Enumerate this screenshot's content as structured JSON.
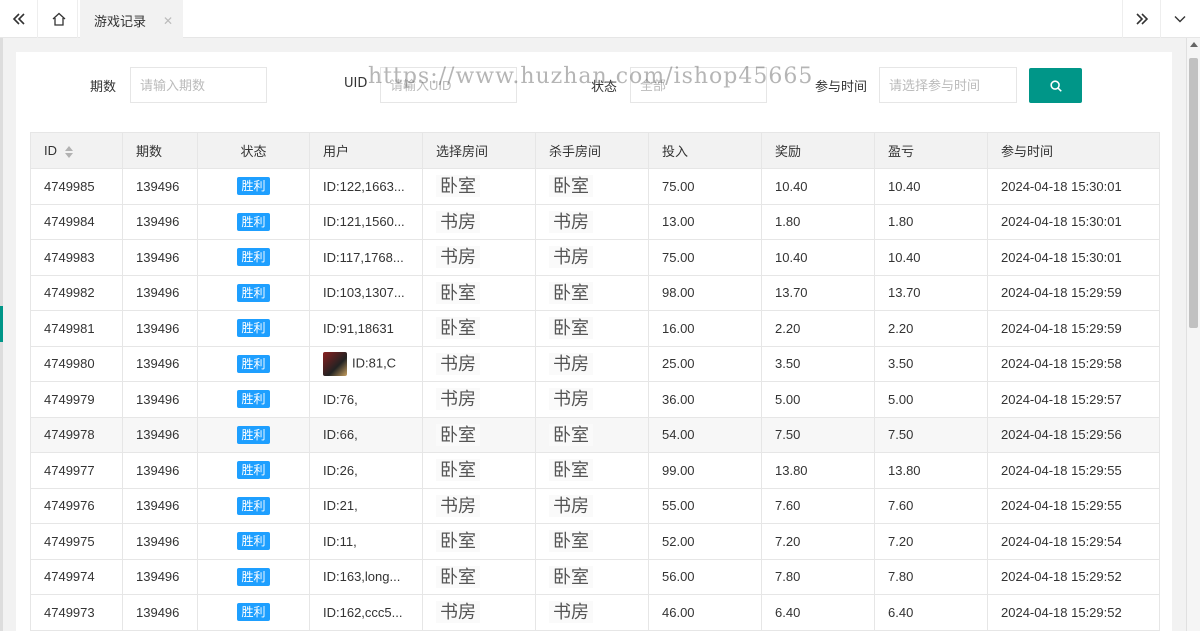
{
  "tabs": {
    "active_label": "游戏记录"
  },
  "search": {
    "period_label": "期数",
    "period_placeholder": "请输入期数",
    "uid_label": "UID",
    "uid_placeholder": "请输入UID",
    "status_label": "状态",
    "status_placeholder": "全部",
    "time_label": "参与时间",
    "time_placeholder": "请选择参与时间"
  },
  "watermark": "https://www.huzhan.com/ishop45665",
  "table": {
    "headers": [
      "ID",
      "期数",
      "状态",
      "用户",
      "选择房间",
      "杀手房间",
      "投入",
      "奖励",
      "盈亏",
      "参与时间"
    ],
    "rows": [
      {
        "id": "4749985",
        "period": "139496",
        "status": "胜利",
        "user": "ID:122,1663...",
        "choose": "卧室",
        "killer": "卧室",
        "bet": "75.00",
        "reward": "10.40",
        "profit": "10.40",
        "time": "2024-04-18 15:30:01"
      },
      {
        "id": "4749984",
        "period": "139496",
        "status": "胜利",
        "user": "ID:121,1560...",
        "choose": "书房",
        "killer": "书房",
        "bet": "13.00",
        "reward": "1.80",
        "profit": "1.80",
        "time": "2024-04-18 15:30:01"
      },
      {
        "id": "4749983",
        "period": "139496",
        "status": "胜利",
        "user": "ID:117,1768...",
        "choose": "书房",
        "killer": "书房",
        "bet": "75.00",
        "reward": "10.40",
        "profit": "10.40",
        "time": "2024-04-18 15:30:01"
      },
      {
        "id": "4749982",
        "period": "139496",
        "status": "胜利",
        "user": "ID:103,1307...",
        "choose": "卧室",
        "killer": "卧室",
        "bet": "98.00",
        "reward": "13.70",
        "profit": "13.70",
        "time": "2024-04-18 15:29:59"
      },
      {
        "id": "4749981",
        "period": "139496",
        "status": "胜利",
        "user": "ID:91,18631",
        "choose": "卧室",
        "killer": "卧室",
        "bet": "16.00",
        "reward": "2.20",
        "profit": "2.20",
        "time": "2024-04-18 15:29:59"
      },
      {
        "id": "4749980",
        "period": "139496",
        "status": "胜利",
        "user": "ID:81,C",
        "choose": "书房",
        "killer": "书房",
        "bet": "25.00",
        "reward": "3.50",
        "profit": "3.50",
        "time": "2024-04-18 15:29:58",
        "avatar": true
      },
      {
        "id": "4749979",
        "period": "139496",
        "status": "胜利",
        "user": "ID:76,",
        "choose": "书房",
        "killer": "书房",
        "bet": "36.00",
        "reward": "5.00",
        "profit": "5.00",
        "time": "2024-04-18 15:29:57"
      },
      {
        "id": "4749978",
        "period": "139496",
        "status": "胜利",
        "user": "ID:66,",
        "choose": "卧室",
        "killer": "卧室",
        "bet": "54.00",
        "reward": "7.50",
        "profit": "7.50",
        "time": "2024-04-18 15:29:56",
        "highlight": true
      },
      {
        "id": "4749977",
        "period": "139496",
        "status": "胜利",
        "user": "ID:26,",
        "choose": "卧室",
        "killer": "卧室",
        "bet": "99.00",
        "reward": "13.80",
        "profit": "13.80",
        "time": "2024-04-18 15:29:55"
      },
      {
        "id": "4749976",
        "period": "139496",
        "status": "胜利",
        "user": "ID:21,",
        "choose": "书房",
        "killer": "书房",
        "bet": "55.00",
        "reward": "7.60",
        "profit": "7.60",
        "time": "2024-04-18 15:29:55"
      },
      {
        "id": "4749975",
        "period": "139496",
        "status": "胜利",
        "user": "ID:11,",
        "choose": "卧室",
        "killer": "卧室",
        "bet": "52.00",
        "reward": "7.20",
        "profit": "7.20",
        "time": "2024-04-18 15:29:54"
      },
      {
        "id": "4749974",
        "period": "139496",
        "status": "胜利",
        "user": "ID:163,long...",
        "choose": "卧室",
        "killer": "卧室",
        "bet": "56.00",
        "reward": "7.80",
        "profit": "7.80",
        "time": "2024-04-18 15:29:52"
      },
      {
        "id": "4749973",
        "period": "139496",
        "status": "胜利",
        "user": "ID:162,ccc5...",
        "choose": "书房",
        "killer": "书房",
        "bet": "46.00",
        "reward": "6.40",
        "profit": "6.40",
        "time": "2024-04-18 15:29:52"
      }
    ]
  },
  "colors": {
    "primary": "#009688",
    "badge": "#1e9fff",
    "header_bg": "#f2f2f2"
  },
  "icons": [
    "double-left-icon",
    "home-icon",
    "close-icon",
    "double-right-icon",
    "chevron-down-icon",
    "search-icon",
    "sort-icon"
  ]
}
